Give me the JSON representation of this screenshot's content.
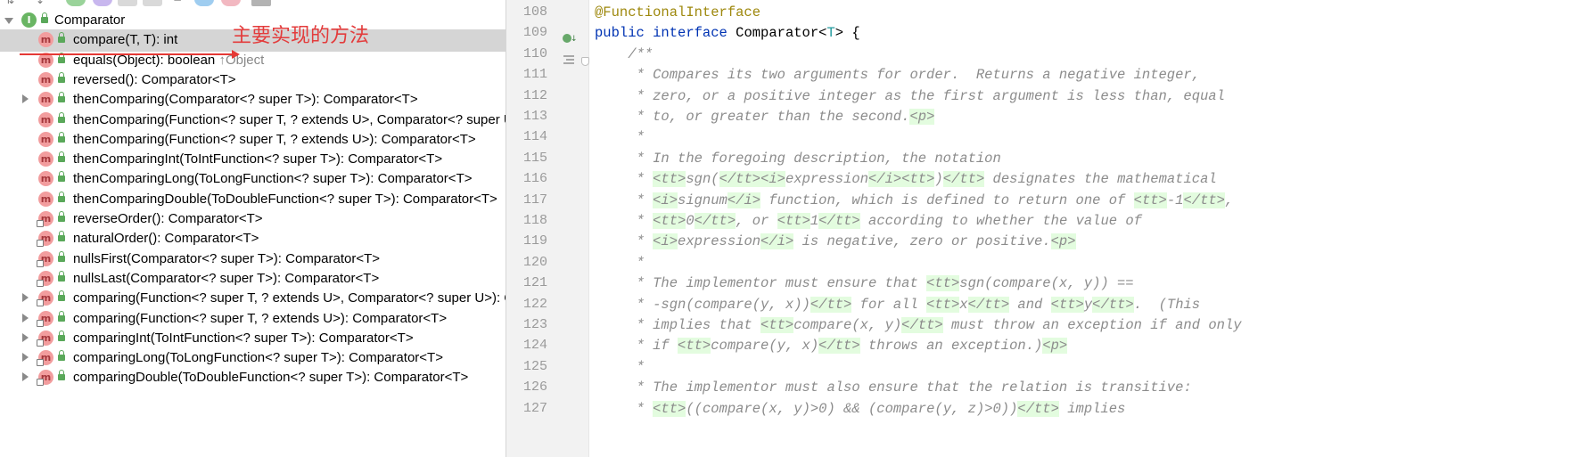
{
  "annotation": {
    "text": "主要实现的方法",
    "color": "#e33c3c"
  },
  "structure": {
    "root": {
      "label": "Comparator",
      "icon": "interface-icon"
    },
    "items": [
      {
        "label": "compare(T, T): int",
        "icon": "method-icon",
        "selected": true
      },
      {
        "label": "equals(Object): boolean",
        "inherited": "↑Object",
        "icon": "method-icon"
      },
      {
        "label": "reversed(): Comparator<T>",
        "icon": "method-icon"
      },
      {
        "label": "thenComparing(Comparator<? super T>): Comparator<T>",
        "icon": "method-icon",
        "expandable": true
      },
      {
        "label": "thenComparing(Function<? super T, ? extends U>, Comparator<? super U>): Comparator<T>",
        "icon": "method-icon"
      },
      {
        "label": "thenComparing(Function<? super T, ? extends U>): Comparator<T>",
        "icon": "method-icon"
      },
      {
        "label": "thenComparingInt(ToIntFunction<? super T>): Comparator<T>",
        "icon": "method-icon"
      },
      {
        "label": "thenComparingLong(ToLongFunction<? super T>): Comparator<T>",
        "icon": "method-icon"
      },
      {
        "label": "thenComparingDouble(ToDoubleFunction<? super T>): Comparator<T>",
        "icon": "method-icon"
      },
      {
        "label": "reverseOrder(): Comparator<T>",
        "icon": "static-method-icon"
      },
      {
        "label": "naturalOrder(): Comparator<T>",
        "icon": "static-method-icon"
      },
      {
        "label": "nullsFirst(Comparator<? super T>): Comparator<T>",
        "icon": "static-method-icon"
      },
      {
        "label": "nullsLast(Comparator<? super T>): Comparator<T>",
        "icon": "static-method-icon"
      },
      {
        "label": "comparing(Function<? super T, ? extends U>, Comparator<? super U>): Comparator<T>",
        "icon": "static-method-icon",
        "expandable": true
      },
      {
        "label": "comparing(Function<? super T, ? extends U>): Comparator<T>",
        "icon": "static-method-icon",
        "expandable": true
      },
      {
        "label": "comparingInt(ToIntFunction<? super T>): Comparator<T>",
        "icon": "static-method-icon",
        "expandable": true
      },
      {
        "label": "comparingLong(ToLongFunction<? super T>): Comparator<T>",
        "icon": "static-method-icon",
        "expandable": true
      },
      {
        "label": "comparingDouble(ToDoubleFunction<? super T>): Comparator<T>",
        "icon": "static-method-icon",
        "expandable": true
      }
    ]
  },
  "editor": {
    "line_numbers": [
      "108",
      "109",
      "110",
      "111",
      "112",
      "113",
      "114",
      "115",
      "116",
      "117",
      "118",
      "119",
      "120",
      "121",
      "122",
      "123",
      "124",
      "125",
      "126",
      "127"
    ],
    "lines": [
      [
        [
          "ann",
          "@FunctionalInterface"
        ]
      ],
      [
        [
          "kw",
          "public "
        ],
        [
          "kw",
          "interface "
        ],
        [
          "cls",
          "Comparator"
        ],
        [
          "pun",
          "<"
        ],
        [
          "tp",
          "T"
        ],
        [
          "pun",
          "> {"
        ]
      ],
      [
        [
          "doc",
          "    /**"
        ]
      ],
      [
        [
          "doc",
          "     * Compares its two arguments for order.  Returns a negative integer,"
        ]
      ],
      [
        [
          "doc",
          "     * zero, or a positive integer as the first argument is less than, equal"
        ]
      ],
      [
        [
          "doc",
          "     * to, or greater than the second."
        ],
        [
          "tag",
          "<p>"
        ]
      ],
      [
        [
          "doc",
          "     *"
        ]
      ],
      [
        [
          "doc",
          "     * In the foregoing description, the notation"
        ]
      ],
      [
        [
          "doc",
          "     * "
        ],
        [
          "tag",
          "<tt>"
        ],
        [
          "doc",
          "sgn("
        ],
        [
          "tag",
          "</tt><i>"
        ],
        [
          "doc",
          "expression"
        ],
        [
          "tag",
          "</i><tt>"
        ],
        [
          "doc",
          ")"
        ],
        [
          "tag",
          "</tt>"
        ],
        [
          "doc",
          " designates the mathematical"
        ]
      ],
      [
        [
          "doc",
          "     * "
        ],
        [
          "tag",
          "<i>"
        ],
        [
          "doc",
          "signum"
        ],
        [
          "tag",
          "</i>"
        ],
        [
          "doc",
          " function, which is defined to return one of "
        ],
        [
          "tag",
          "<tt>"
        ],
        [
          "doc",
          "-1"
        ],
        [
          "tag",
          "</tt>"
        ],
        [
          "doc",
          ","
        ]
      ],
      [
        [
          "doc",
          "     * "
        ],
        [
          "tag",
          "<tt>"
        ],
        [
          "doc",
          "0"
        ],
        [
          "tag",
          "</tt>"
        ],
        [
          "doc",
          ", or "
        ],
        [
          "tag",
          "<tt>"
        ],
        [
          "doc",
          "1"
        ],
        [
          "tag",
          "</tt>"
        ],
        [
          "doc",
          " according to whether the value of"
        ]
      ],
      [
        [
          "doc",
          "     * "
        ],
        [
          "tag",
          "<i>"
        ],
        [
          "doc",
          "expression"
        ],
        [
          "tag",
          "</i>"
        ],
        [
          "doc",
          " is negative, zero or positive."
        ],
        [
          "tag",
          "<p>"
        ]
      ],
      [
        [
          "doc",
          "     *"
        ]
      ],
      [
        [
          "doc",
          "     * The implementor must ensure that "
        ],
        [
          "tag",
          "<tt>"
        ],
        [
          "doc",
          "sgn(compare(x, y)) =="
        ]
      ],
      [
        [
          "doc",
          "     * -sgn(compare(y, x))"
        ],
        [
          "tag",
          "</tt>"
        ],
        [
          "doc",
          " for all "
        ],
        [
          "tag",
          "<tt>"
        ],
        [
          "doc",
          "x"
        ],
        [
          "tag",
          "</tt>"
        ],
        [
          "doc",
          " and "
        ],
        [
          "tag",
          "<tt>"
        ],
        [
          "doc",
          "y"
        ],
        [
          "tag",
          "</tt>"
        ],
        [
          "doc",
          ".  (This"
        ]
      ],
      [
        [
          "doc",
          "     * implies that "
        ],
        [
          "tag",
          "<tt>"
        ],
        [
          "doc",
          "compare(x, y)"
        ],
        [
          "tag",
          "</tt>"
        ],
        [
          "doc",
          " must throw an exception if and only"
        ]
      ],
      [
        [
          "doc",
          "     * if "
        ],
        [
          "tag",
          "<tt>"
        ],
        [
          "doc",
          "compare(y, x)"
        ],
        [
          "tag",
          "</tt>"
        ],
        [
          "doc",
          " throws an exception.)"
        ],
        [
          "tag",
          "<p>"
        ]
      ],
      [
        [
          "doc",
          "     *"
        ]
      ],
      [
        [
          "doc",
          "     * The implementor must also ensure that the relation is transitive:"
        ]
      ],
      [
        [
          "doc",
          "     * "
        ],
        [
          "tag",
          "<tt>"
        ],
        [
          "doc",
          "((compare(x, y)&gt;0) &amp;&amp; (compare(y, z)&gt;0))"
        ],
        [
          "tag",
          "</tt>"
        ],
        [
          "doc",
          " implies"
        ]
      ]
    ]
  }
}
